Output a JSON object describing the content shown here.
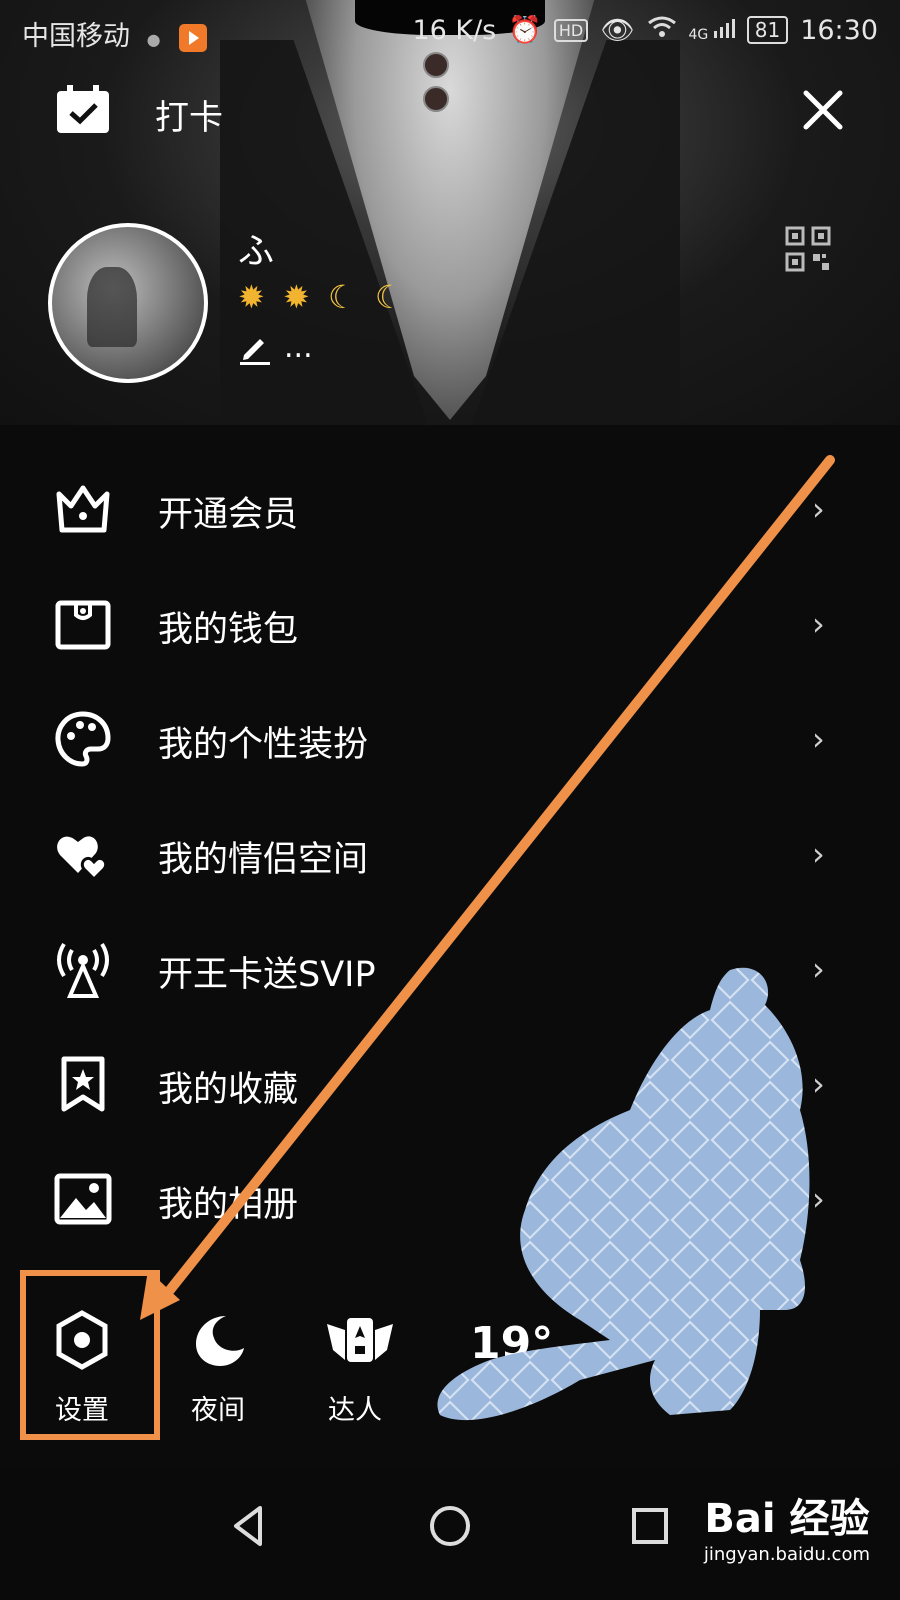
{
  "status": {
    "carrier": "中国移动",
    "net_speed": "16 K/s",
    "hd": "HD",
    "signal": "4G",
    "battery": "81",
    "time": "16:30"
  },
  "header": {
    "checkin_label": "打卡",
    "username": "ふ",
    "level_icons": [
      "sun",
      "sun",
      "moon",
      "moon"
    ],
    "signature": "..."
  },
  "menu": [
    {
      "label": "开通会员",
      "icon": "crown-icon"
    },
    {
      "label": "我的钱包",
      "icon": "wallet-icon"
    },
    {
      "label": "我的个性装扮",
      "icon": "palette-icon"
    },
    {
      "label": "我的情侣空间",
      "icon": "hearts-icon"
    },
    {
      "label": "开王卡送SVIP",
      "icon": "signal-tower-icon"
    },
    {
      "label": "我的收藏",
      "icon": "bookmark-star-icon"
    },
    {
      "label": "我的相册",
      "icon": "photo-icon"
    }
  ],
  "bottom": {
    "settings": "设置",
    "night": "夜间",
    "expert": "达人",
    "weather_temp": "19°"
  },
  "watermark": {
    "title": "Bai 经验",
    "url": "jingyan.baidu.com"
  },
  "colors": {
    "highlight": "#f0914a",
    "background": "#0b0b0b"
  }
}
